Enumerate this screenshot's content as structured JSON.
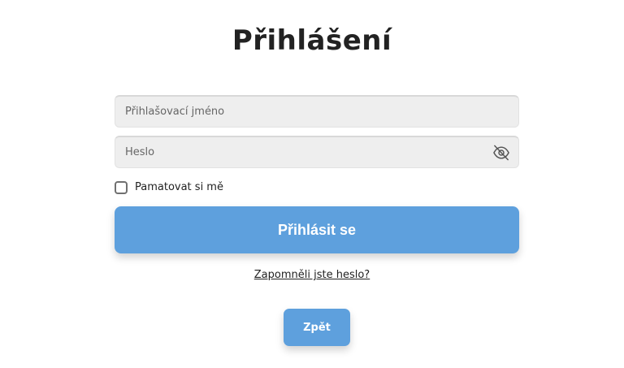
{
  "page": {
    "title": "Přihlášení"
  },
  "form": {
    "username": {
      "placeholder": "Přihlašovací jméno",
      "value": ""
    },
    "password": {
      "placeholder": "Heslo",
      "value": "",
      "toggle_icon": "eye-slash-icon"
    },
    "remember": {
      "label": "Pamatovat si mě",
      "checked": false
    },
    "submit_label": "Přihlásit se",
    "forgot_label": "Zapomněli jste heslo?",
    "back_label": "Zpět"
  },
  "colors": {
    "primary": "#5ea0dd",
    "field_bg": "#eeeeee",
    "text": "#222222"
  }
}
